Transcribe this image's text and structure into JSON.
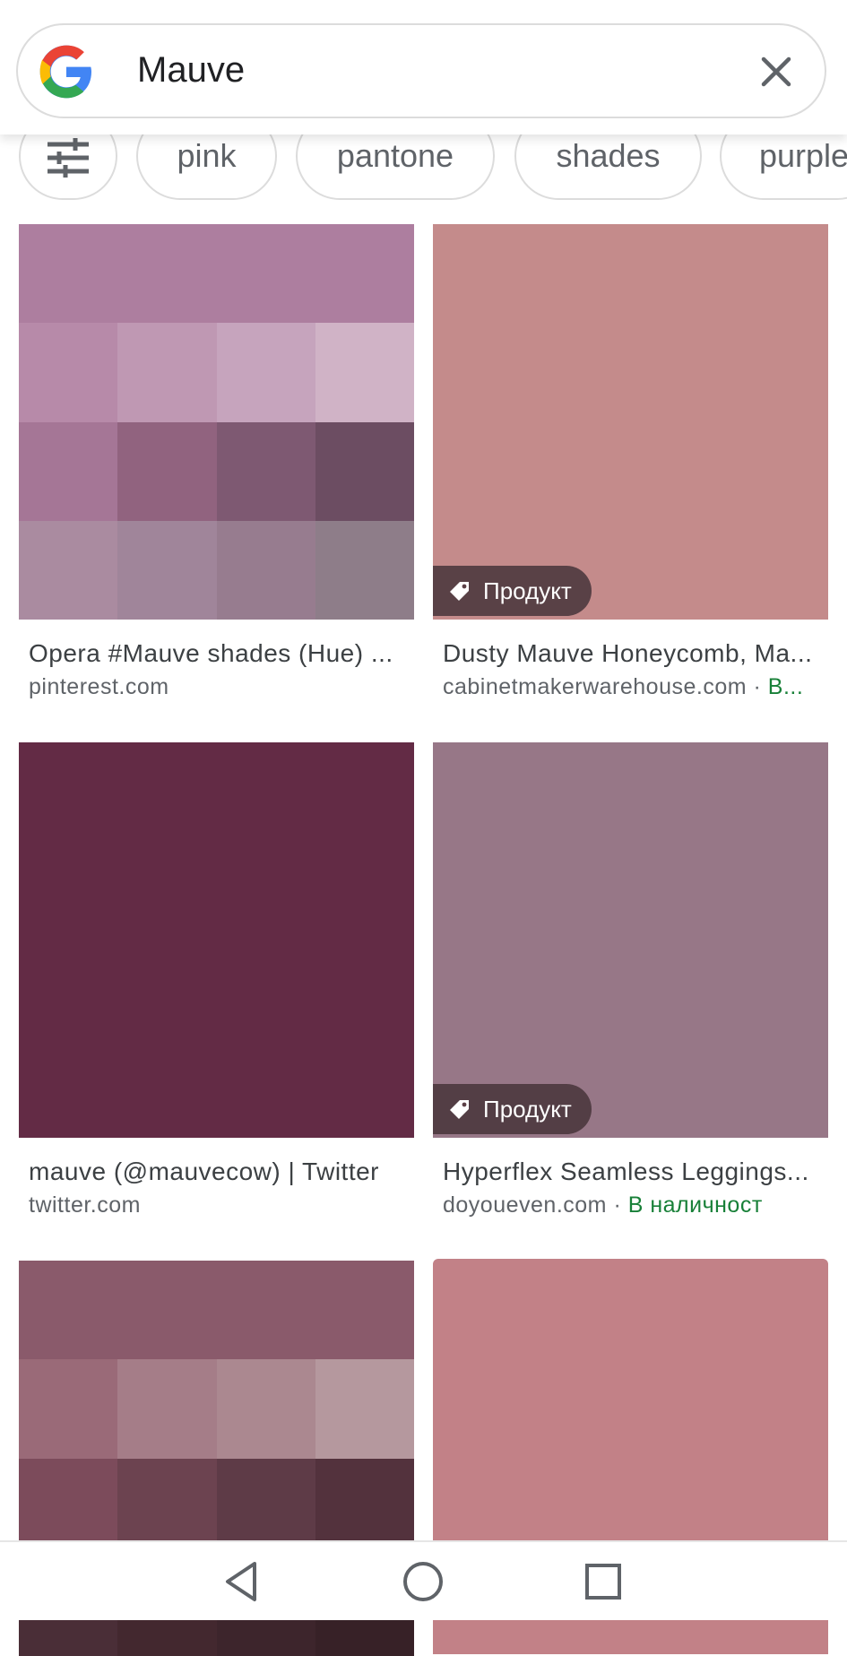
{
  "search": {
    "query": "Mauve"
  },
  "chips": [
    {
      "label": "pink"
    },
    {
      "label": "pantone"
    },
    {
      "label": "shades"
    },
    {
      "label": "purple"
    }
  ],
  "results": [
    {
      "title": "Opera #Mauve shades (Hue) ...",
      "source": "pinterest.com",
      "stock": ""
    },
    {
      "title": "Dusty Mauve Honeycomb, Ma...",
      "source": "cabinetmakerwarehouse.com · ",
      "stock": "В...",
      "badge": "Продукт"
    },
    {
      "title": "mauve (@mauvecow) | Twitter",
      "source": "twitter.com",
      "stock": ""
    },
    {
      "title": "Hyperflex Seamless Leggings...",
      "source": "doyoueven.com · ",
      "stock": "В наличност",
      "badge": "Продукт"
    }
  ],
  "icons": {
    "logo": "google-logo",
    "clear": "close-icon",
    "filter": "tune-icon",
    "tag": "tag-icon",
    "back": "back-triangle-icon",
    "home": "home-circle-icon",
    "recents": "recents-square-icon"
  },
  "colors": {
    "accent_stock": "#188038",
    "result2": "#c48b8b",
    "result3": "#632b45",
    "result4": "#977787",
    "result6": "#c28187"
  }
}
